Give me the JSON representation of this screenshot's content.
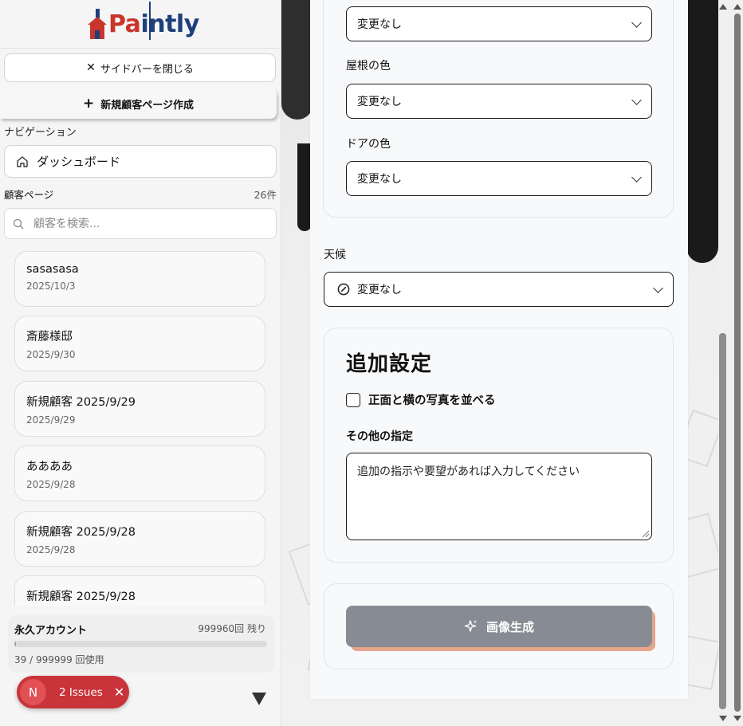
{
  "brand": {
    "logo_text_a": "Pa",
    "logo_text_b": "intly"
  },
  "sidebar": {
    "close_label": "サイドバーを閉じる",
    "new_customer_label": "新規顧客ページ作成",
    "nav_section": "ナビゲーション",
    "dashboard_label": "ダッシュボード",
    "customers_section": "顧客ページ",
    "customers_count": "26件",
    "search_placeholder": "顧客を検索...",
    "customers": [
      {
        "name": "sasasasa",
        "date": "2025/10/3"
      },
      {
        "name": "斎藤様邸",
        "date": "2025/9/30"
      },
      {
        "name": "新規顧客 2025/9/29",
        "date": "2025/9/29"
      },
      {
        "name": "ああああ",
        "date": "2025/9/28"
      },
      {
        "name": "新規顧客 2025/9/28",
        "date": "2025/9/28"
      },
      {
        "name": "新規顧客 2025/9/28",
        "date": ""
      }
    ],
    "plan": {
      "title": "永久アカウント",
      "remaining": "999960回 残り",
      "usage": "39 / 999999 回使用",
      "used_fraction": 4e-05
    }
  },
  "issues": {
    "badge": "N",
    "label": "2 Issues"
  },
  "form": {
    "top_select_value": "変更なし",
    "roof_label": "屋根の色",
    "roof_value": "変更なし",
    "door_label": "ドアの色",
    "door_value": "変更なし",
    "weather_label": "天候",
    "weather_value": "変更なし",
    "additional_title": "追加設定",
    "side_by_side_label": "正面と横の写真を並べる",
    "other_label": "その他の指定",
    "other_placeholder": "追加の指示や要望があれば入力してください",
    "generate_label": "画像生成"
  },
  "colors": {
    "brand_navy": "#1d3f7a",
    "brand_red": "#c8352b",
    "generate_button": "#878b93",
    "generate_shadow": "#e6a58b",
    "issues_red": "#c9343a"
  }
}
